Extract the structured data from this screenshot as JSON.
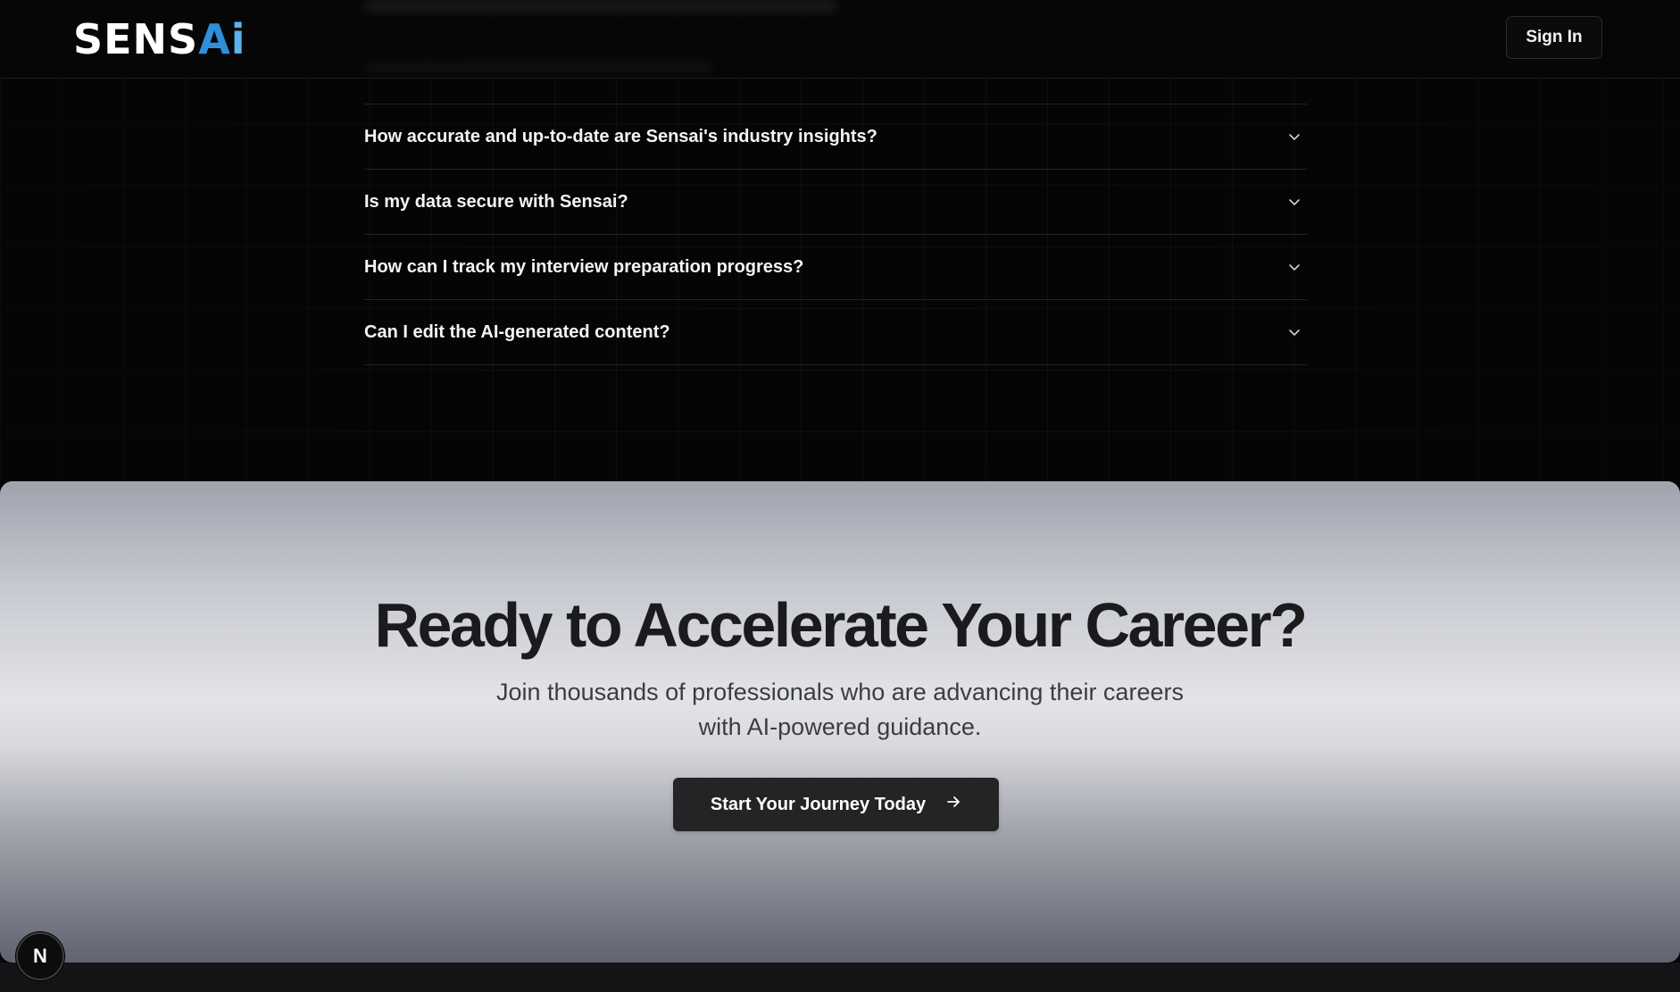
{
  "header": {
    "logo": {
      "part1": "SENS",
      "part2": "A",
      "part3": "i"
    },
    "sign_in_label": "Sign In"
  },
  "faq": {
    "items": [
      {
        "question": "How accurate and up-to-date are Sensai's industry insights?"
      },
      {
        "question": "Is my data secure with Sensai?"
      },
      {
        "question": "How can I track my interview preparation progress?"
      },
      {
        "question": "Can I edit the AI-generated content?"
      }
    ]
  },
  "cta": {
    "title": "Ready to Accelerate Your Career?",
    "subtitle": "Join thousands of professionals who are advancing their careers with AI-powered guidance.",
    "button_label": "Start Your Journey Today"
  },
  "badge": {
    "letter": "N"
  },
  "colors": {
    "logo_accent": "#2f8fd8",
    "cta_button": "#242426",
    "background": "#050505"
  },
  "icons": {
    "faq_chevron": "chevron-down-icon",
    "cta_arrow": "arrow-right-icon"
  }
}
